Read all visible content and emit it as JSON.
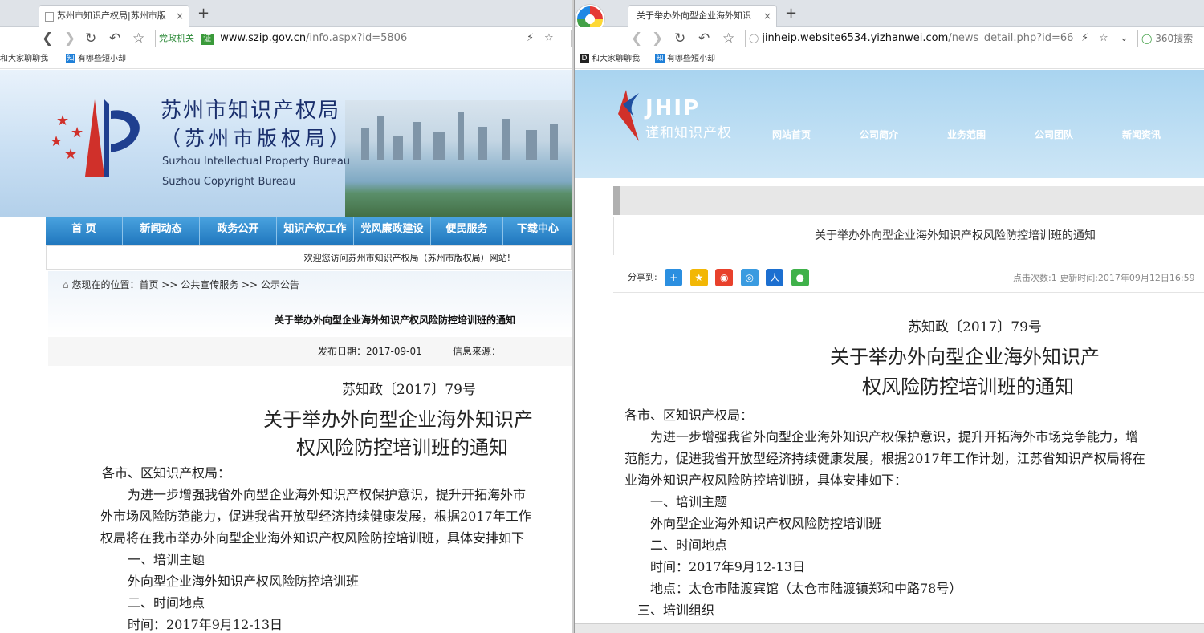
{
  "left": {
    "tab_title": "苏州市知识产权局|苏州市版",
    "address": {
      "badge": "党政机关",
      "cert": "证",
      "host": "www.szip.gov.cn",
      "path": "/info.aspx?id=5806"
    },
    "bookmarks": [
      "和大家聊聊我",
      "有哪些短小却"
    ],
    "site": {
      "title_cn": "苏州市知识产权局",
      "title_cn2": "（苏州市版权局）",
      "title_en1": "Suzhou Intellectual Property Bureau",
      "title_en2": "Suzhou Copyright Bureau",
      "nav": [
        "首  页",
        "新闻动态",
        "政务公开",
        "知识产权工作",
        "党风廉政建设",
        "便民服务",
        "下载中心"
      ],
      "welcome": "欢迎您访问苏州市知识产权局（苏州市版权局）网站!",
      "breadcrumb": "您现在的位置：首页 >> 公共宣传服务 >> 公示公告",
      "article_title": "关于举办外向型企业海外知识产权风险防控培训班的通知",
      "publish_date": "发布日期：2017-09-01",
      "source": "信息来源："
    },
    "doc": {
      "number": "苏知政〔2017〕79号",
      "title1": "关于举办外向型企业海外知识产",
      "title2": "权风险防控培训班的通知",
      "lines": [
        "各市、区知识产权局：",
        "　　为进一步增强我省外向型企业海外知识产权保护意识，提升开拓海外市",
        "外市场风险防范能力，促进我省开放型经济持续健康发展，根据2017年工作",
        "权局将在我市举办外向型企业海外知识产权风险防控培训班，具体安排如下",
        "　　一、培训主题",
        "　　外向型企业海外知识产权风险防控培训班",
        "　　二、时间地点",
        "　　时间：2017年9月12-13日"
      ]
    }
  },
  "right": {
    "tab_title": "关于举办外向型企业海外知识",
    "address": {
      "host": "jinheip.website6534.yizhanwei.com",
      "path": "/news_detail.php?id=66"
    },
    "search_label": "360搜索",
    "bookmarks": [
      "和大家聊聊我",
      "有哪些短小却"
    ],
    "site": {
      "brand": "JHIP",
      "brand_sub": "谨和知识产权",
      "menu": [
        "网站首页",
        "公司简介",
        "业务范围",
        "公司团队",
        "新闻资讯"
      ],
      "article_title": "关于举办外向型企业海外知识产权风险防控培训班的通知",
      "share_label": "分享到:",
      "meta": "点击次数:1  更新时间:2017年09月12日16:59"
    },
    "doc": {
      "number": "苏知政〔2017〕79号",
      "title1": "关于举办外向型企业海外知识产",
      "title2": "权风险防控培训班的通知",
      "lines": [
        "各市、区知识产权局：",
        "　　为进一步增强我省外向型企业海外知识产权保护意识，提升开拓海外市场竞争能力，增",
        "范能力，促进我省开放型经济持续健康发展，根据2017年工作计划，江苏省知识产权局将在",
        "业海外知识产权风险防控培训班，具体安排如下：",
        "　　一、培训主题",
        "　　外向型企业海外知识产权风险防控培训班",
        "　　二、时间地点",
        "　　时间：2017年9月12-13日",
        "　　地点：太仓市陆渡宾馆（太仓市陆渡镇郑和中路78号）",
        "　三、培训组织"
      ]
    }
  }
}
